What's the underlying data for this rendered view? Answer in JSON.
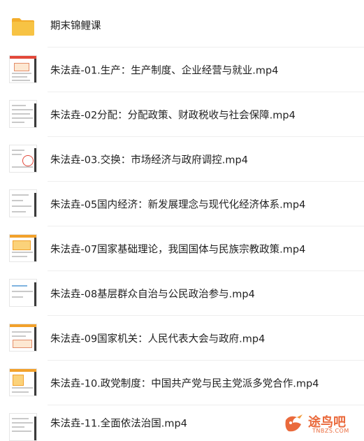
{
  "colors": {
    "folder": "#f7c344",
    "folder_tab": "#f3ad2b",
    "watermark": "#ea6a3c"
  },
  "items": [
    {
      "type": "folder",
      "name": "期末锦鲤课",
      "icon": "folder-icon"
    },
    {
      "type": "video",
      "name": "朱法垚-01.生产：生产制度、企业经营与就业.mp4",
      "icon": "video-thumbnail"
    },
    {
      "type": "video",
      "name": "朱法垚-02分配：分配政策、财政税收与社会保障.mp4",
      "icon": "video-thumbnail"
    },
    {
      "type": "video",
      "name": "朱法垚-03.交换：市场经济与政府调控.mp4",
      "icon": "video-thumbnail"
    },
    {
      "type": "video",
      "name": "朱法垚-05国内经济：新发展理念与现代化经济体系.mp4",
      "icon": "video-thumbnail"
    },
    {
      "type": "video",
      "name": "朱法垚-07国家基础理论，我国国体与民族宗教政策.mp4",
      "icon": "video-thumbnail"
    },
    {
      "type": "video",
      "name": "朱法垚-08基层群众自治与公民政治参与.mp4",
      "icon": "video-thumbnail"
    },
    {
      "type": "video",
      "name": "朱法垚-09国家机关：人民代表大会与政府.mp4",
      "icon": "video-thumbnail"
    },
    {
      "type": "video",
      "name": "朱法垚-10.政党制度：中国共产党与民主党派多党合作.mp4",
      "icon": "video-thumbnail"
    },
    {
      "type": "video",
      "name": "朱法垚-11.全面依法治国.mp4",
      "icon": "video-thumbnail"
    }
  ],
  "watermark": {
    "text": "途鸟吧",
    "subtext": "TNBZS.COM"
  }
}
